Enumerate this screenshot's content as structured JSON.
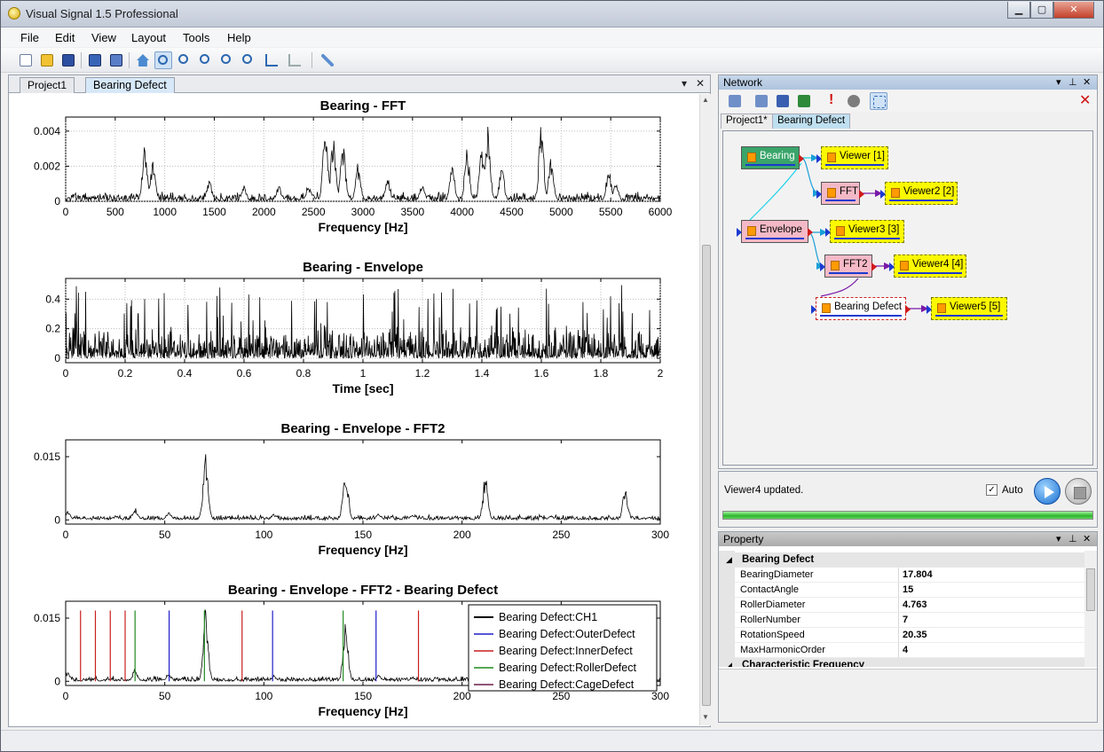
{
  "window": {
    "title": "Visual Signal 1.5 Professional"
  },
  "menu": [
    "File",
    "Edit",
    "View",
    "Layout",
    "Tools",
    "Help"
  ],
  "doc_tabs": [
    "Project1",
    "Bearing Defect"
  ],
  "network": {
    "title": "Network",
    "tabs": [
      "Project1*",
      "Bearing Defect"
    ],
    "nodes": {
      "bearing": "Bearing",
      "viewer1": "Viewer [1]",
      "fft": "FFT",
      "viewer2": "Viewer2 [2]",
      "envelope": "Envelope",
      "viewer3": "Viewer3 [3]",
      "fft2": "FFT2",
      "viewer4": "Viewer4 [4]",
      "bearing_defect": "Bearing Defect",
      "viewer5": "Viewer5 [5]"
    }
  },
  "status": {
    "message": "Viewer4 updated.",
    "auto_label": "Auto",
    "auto_checked": true
  },
  "property": {
    "title": "Property",
    "section1": "Bearing Defect",
    "rows": [
      {
        "key": "BearingDiameter",
        "value": "17.804"
      },
      {
        "key": "ContactAngle",
        "value": "15"
      },
      {
        "key": "RollerDiameter",
        "value": "4.763"
      },
      {
        "key": "RollerNumber",
        "value": "7"
      },
      {
        "key": "RotationSpeed",
        "value": "20.35"
      },
      {
        "key": "MaxHarmonicOrder",
        "value": "4"
      }
    ],
    "section2": "Characteristic Frequency"
  },
  "icons": {
    "toolbar": [
      "new-icon",
      "open-icon",
      "save-icon",
      "add-viewer-icon",
      "viewer-save-icon",
      "home-icon",
      "zoom-icon",
      "zoom-in-icon",
      "zoom-fit-icon",
      "zoom-x-icon",
      "zoom-y-icon",
      "axis-scale-icon",
      "axis-scale-disabled-icon",
      "tools-icon"
    ],
    "network_toolbar": [
      "add-node-icon",
      "copy-node-icon",
      "viewer-node-icon",
      "excel-icon",
      "alert-icon",
      "recycle-icon",
      "select-rect-icon",
      "delete-icon"
    ]
  },
  "chart_data": [
    {
      "type": "line",
      "title": "Bearing - FFT",
      "xlabel": "Frequency [Hz]",
      "ylabel": "",
      "xlim": [
        0,
        6000
      ],
      "ylim": [
        0,
        0.0048
      ],
      "xticks": [
        0,
        500,
        1000,
        1500,
        2000,
        2500,
        3000,
        3500,
        4000,
        4500,
        5000,
        5500,
        6000
      ],
      "yticks": [
        0,
        0.002,
        0.004
      ],
      "ytick_labels": [
        "0",
        "0.002",
        "0.004"
      ],
      "grid": true,
      "series": [
        {
          "color": "#000000",
          "peaks": [
            [
              800,
              0.0035
            ],
            [
              880,
              0.0025
            ],
            [
              1450,
              0.0013
            ],
            [
              1800,
              0.0009
            ],
            [
              2150,
              0.0009
            ],
            [
              2450,
              0.001
            ],
            [
              2620,
              0.0043
            ],
            [
              2700,
              0.004
            ],
            [
              2800,
              0.0034
            ],
            [
              2950,
              0.0022
            ],
            [
              3250,
              0.0014
            ],
            [
              3600,
              0.001
            ],
            [
              3900,
              0.0022
            ],
            [
              4050,
              0.003
            ],
            [
              4200,
              0.0034
            ],
            [
              4260,
              0.0043
            ],
            [
              4400,
              0.002
            ],
            [
              4800,
              0.0045
            ],
            [
              4900,
              0.0025
            ],
            [
              5480,
              0.002
            ],
            [
              5550,
              0.0012
            ]
          ],
          "noise_floor": 0.0006
        }
      ]
    },
    {
      "type": "line",
      "title": "Bearing - Envelope",
      "xlabel": "Time [sec]",
      "ylabel": "",
      "xlim": [
        0,
        2
      ],
      "ylim": [
        -0.03,
        0.54
      ],
      "xticks": [
        0,
        0.2,
        0.4,
        0.6,
        0.8,
        1,
        1.2,
        1.4,
        1.6,
        1.8,
        2
      ],
      "yticks": [
        0,
        0.2,
        0.4
      ],
      "grid": true,
      "series": [
        {
          "color": "#000000",
          "noise_level": 0.18,
          "spike_max": 0.5
        }
      ]
    },
    {
      "type": "line",
      "title": "Bearing - Envelope - FFT2",
      "xlabel": "Frequency [Hz]",
      "ylabel": "",
      "xlim": [
        0,
        300
      ],
      "ylim": [
        -0.001,
        0.019
      ],
      "xticks": [
        0,
        50,
        100,
        150,
        200,
        250,
        300
      ],
      "yticks": [
        0,
        0.015
      ],
      "grid": false,
      "series": [
        {
          "color": "#000000",
          "peaks": [
            [
              1,
              0.0022
            ],
            [
              35,
              0.003
            ],
            [
              52,
              0.002
            ],
            [
              70.6,
              0.0175
            ],
            [
              105,
              0.0015
            ],
            [
              141.2,
              0.014
            ],
            [
              158,
              0.0015
            ],
            [
              175,
              0.0012
            ],
            [
              211.8,
              0.011
            ],
            [
              245,
              0.0012
            ],
            [
              282.4,
              0.008
            ]
          ],
          "noise_floor": 0.0013
        }
      ]
    },
    {
      "type": "line",
      "title": "Bearing - Envelope - FFT2 - Bearing Defect",
      "xlabel": "Frequency [Hz]",
      "ylabel": "",
      "xlim": [
        0,
        300
      ],
      "ylim": [
        -0.001,
        0.019
      ],
      "xticks": [
        0,
        50,
        100,
        150,
        200,
        250,
        300
      ],
      "yticks": [
        0,
        0.015
      ],
      "grid": false,
      "legend_position": "top-right",
      "series": [
        {
          "name": "Bearing Defect:CH1",
          "color": "#000000",
          "peaks": [
            [
              1,
              0.0022
            ],
            [
              35,
              0.003
            ],
            [
              52,
              0.002
            ],
            [
              70.6,
              0.0175
            ],
            [
              105,
              0.0015
            ],
            [
              141.2,
              0.014
            ],
            [
              158,
              0.0015
            ],
            [
              175,
              0.0012
            ],
            [
              211.8,
              0.011
            ],
            [
              245,
              0.0012
            ],
            [
              282.4,
              0.008
            ]
          ],
          "noise_floor": 0.0013
        },
        {
          "name": "Bearing Defect:OuterDefect",
          "color": "#1f1fc8",
          "lines": [
            52.2,
            104.4,
            156.6
          ],
          "height": 0.0168
        },
        {
          "name": "Bearing Defect:InnerDefect",
          "color": "#c81f1f",
          "lines": [
            7.5,
            15,
            22.5,
            30,
            89,
            178
          ],
          "height": 0.0168
        },
        {
          "name": "Bearing Defect:RollerDefect",
          "color": "#1f8c1f",
          "lines": [
            35,
            70,
            140
          ],
          "height": 0.0168
        },
        {
          "name": "Bearing Defect:CageDefect",
          "color": "#6a1f4a",
          "lines": [],
          "height": 0
        }
      ]
    }
  ]
}
